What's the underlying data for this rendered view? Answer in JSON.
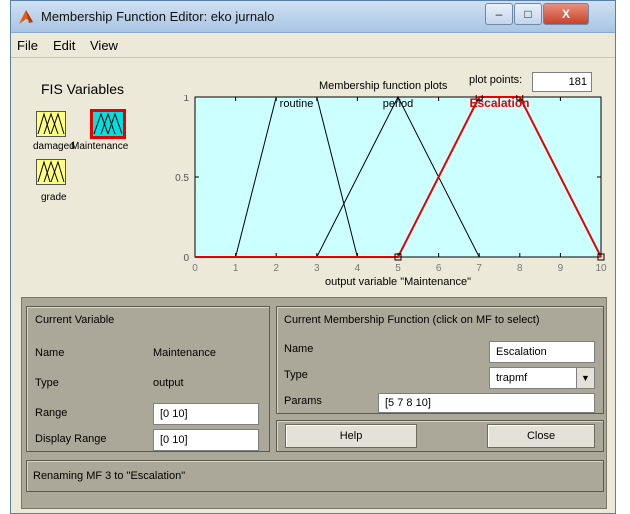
{
  "window": {
    "title": "Membership Function Editor: eko jurnalo",
    "controls": {
      "minimize": "–",
      "maximize": "□",
      "close": "X"
    }
  },
  "menu": [
    "File",
    "Edit",
    "View"
  ],
  "fis": {
    "title": "FIS Variables",
    "inputs": [
      {
        "name": "damaged",
        "selected": false
      },
      {
        "name": "grade",
        "selected": false
      }
    ],
    "outputs": [
      {
        "name": "Maintenance",
        "selected": true
      }
    ]
  },
  "plot": {
    "header": "Membership function plots",
    "plot_points_label": "plot points:",
    "plot_points_value": "181"
  },
  "chart_data": {
    "type": "line",
    "xlabel": "output variable \"Maintenance\"",
    "xlim": [
      0,
      10
    ],
    "ylim": [
      0,
      1
    ],
    "xticks": [
      "0",
      "1",
      "2",
      "3",
      "4",
      "5",
      "6",
      "7",
      "8",
      "9",
      "10"
    ],
    "yticks": [
      "0",
      "0.5",
      "1"
    ],
    "background": "#ccffff",
    "series": [
      {
        "name": "routine",
        "shape": "trapmf",
        "params": [
          1,
          2,
          3,
          4
        ],
        "color": "#000000",
        "selected": false
      },
      {
        "name": "period",
        "shape": "trimf",
        "params": [
          3,
          5,
          7
        ],
        "color": "#000000",
        "selected": false
      },
      {
        "name": "Escalation",
        "shape": "trapmf",
        "params": [
          5,
          7,
          8,
          10
        ],
        "color": "#e60000",
        "selected": true
      }
    ]
  },
  "current_variable": {
    "title": "Current Variable",
    "name_label": "Name",
    "name_value": "Maintenance",
    "type_label": "Type",
    "type_value": "output",
    "range_label": "Range",
    "range_value": "[0 10]",
    "display_range_label": "Display Range",
    "display_range_value": "[0 10]"
  },
  "current_mf": {
    "title": "Current Membership Function (click on MF to select)",
    "name_label": "Name",
    "name_value": "Escalation",
    "type_label": "Type",
    "type_value": "trapmf",
    "params_label": "Params",
    "params_value": "[5 7 8 10]"
  },
  "buttons": {
    "help": "Help",
    "close": "Close"
  },
  "status": "Renaming MF 3 to \"Escalation\""
}
